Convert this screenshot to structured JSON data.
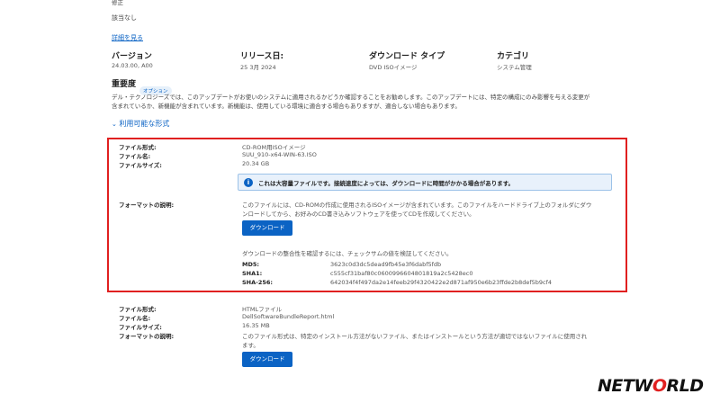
{
  "top": {
    "cut_text": "修正",
    "none_text": "該当なし",
    "details_link": "詳細を見る"
  },
  "info_grid": {
    "version_label": "バージョン",
    "version_value": "24.03.00, A00",
    "release_label": "リリース日:",
    "release_value": "25 3月 2024",
    "dltype_label": "ダウンロード タイプ",
    "dltype_value": "DVD ISOイメージ",
    "category_label": "カテゴリ",
    "category_value": "システム管理"
  },
  "importance": {
    "label": "重要度",
    "badge": "オプション",
    "desc_line1": "デル・テクノロジーズでは、このアップデートがお使いのシステムに適用されるかどうか確認することをお勧めします。このアップデートには、特定の構成にのみ影響を与える変更が",
    "desc_line2": "含まれているか、新機能が含まれています。新機能は、使用している環境に適合する場合もありますが、適合しない場合もあります。"
  },
  "formats_toggle": "利用可能な形式",
  "format1": {
    "format_label": "ファイル形式:",
    "format_value": "CD-ROM用ISOイメージ",
    "name_label": "ファイル名:",
    "name_value": "SUU_910-x64-WIN-63.ISO",
    "size_label": "ファイルサイズ:",
    "size_value": "20.34 GB",
    "notice": "これは大容量ファイルです。接続速度によっては、ダウンロードに時間がかかる場合があります。",
    "desc_label": "フォーマットの説明:",
    "desc_line1": "このファイルには、CD-ROMの作成に使用されるISOイメージが含まれています。このファイルをハードドライブ上のフォルダにダウ",
    "desc_line2": "ンロードしてから、お好みのCD書き込みソフトウェアを使ってCDを作成してください。",
    "download_label": "ダウンロード",
    "checksum_text": "ダウンロードの整合性を確認するには、チェックサムの値を検証してください。",
    "md5_label": "MD5:",
    "md5_value": "3623c0d3dc5dead9fb45e3f6dabf5fdb",
    "sha1_label": "SHA1:",
    "sha1_value": "c555cf31baf80c0600996604801819a2c5428ec0",
    "sha256_label": "SHA-256:",
    "sha256_value": "642034f4f497da2e14feeb29f4320422e2d871af950e6b23ffde2b8def5b9cf4"
  },
  "format2": {
    "format_label": "ファイル形式:",
    "format_value": "HTMLファイル",
    "name_label": "ファイル名:",
    "name_value": "DellSoftwareBundleReport.html",
    "size_label": "ファイルサイズ:",
    "size_value": "16.35 MB",
    "desc_label": "フォーマットの説明:",
    "desc_line1": "このファイル形式は、特定のインストール方法がないファイル、またはインストールという方法が適切ではないファイルに使用され",
    "desc_line2": "ます。",
    "download_label": "ダウンロード"
  },
  "logo": {
    "pre": "NETW",
    "o": "O",
    "post": "RLD"
  },
  "colors": {
    "link": "#0b63c4",
    "highlight_border": "#e02020",
    "info_bg": "#e8f1fb"
  }
}
